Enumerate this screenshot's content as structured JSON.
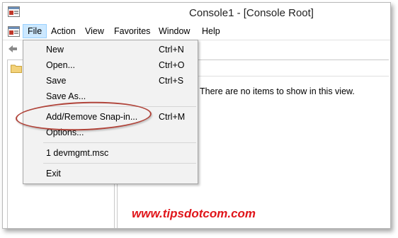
{
  "window": {
    "title": "Console1 - [Console Root]"
  },
  "menubar": {
    "items": [
      "File",
      "Action",
      "View",
      "Favorites",
      "Window",
      "Help"
    ],
    "active": "File"
  },
  "file_menu": {
    "items": [
      {
        "label": "New",
        "shortcut": "Ctrl+N"
      },
      {
        "label": "Open...",
        "shortcut": "Ctrl+O"
      },
      {
        "label": "Save",
        "shortcut": "Ctrl+S"
      },
      {
        "label": "Save As...",
        "shortcut": ""
      },
      {
        "label": "Add/Remove Snap-in...",
        "shortcut": "Ctrl+M"
      },
      {
        "label": "Options...",
        "shortcut": ""
      },
      {
        "label": "1 devmgmt.msc",
        "shortcut": ""
      },
      {
        "label": "Exit",
        "shortcut": ""
      }
    ],
    "highlighted_item": "Add/Remove Snap-in..."
  },
  "result_pane": {
    "empty_message": "There are no items to show in this view."
  },
  "watermark": "www.tipsdotcom.com",
  "colors": {
    "menu_active_bg": "#cce8ff",
    "annotation_oval": "#b0443a",
    "watermark": "#e0151a"
  },
  "icons": [
    "mmc-app-icon",
    "back-arrow-icon",
    "folder-icon"
  ]
}
